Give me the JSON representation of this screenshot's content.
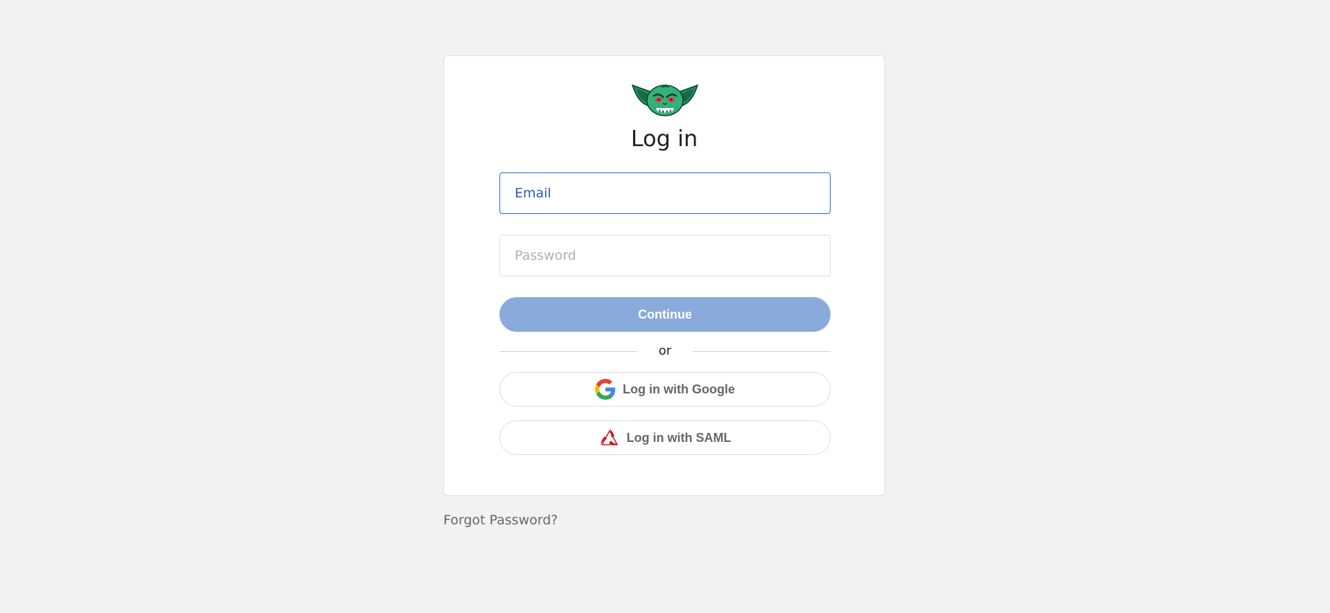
{
  "login": {
    "title": "Log in",
    "email_placeholder": "Email",
    "password_placeholder": "Password",
    "continue_label": "Continue",
    "divider_text": "or",
    "google_label": "Log in with Google",
    "saml_label": "Log in with SAML",
    "forgot_password_label": "Forgot Password?"
  },
  "icons": {
    "logo": "goblin-logo-icon",
    "google": "google-icon",
    "saml": "saml-icon"
  },
  "colors": {
    "page_background": "#f2f2f2",
    "email_focus_border": "#2f5fc8",
    "continue_disabled": "#8aaadb",
    "logo_green": "#2fb37a"
  }
}
